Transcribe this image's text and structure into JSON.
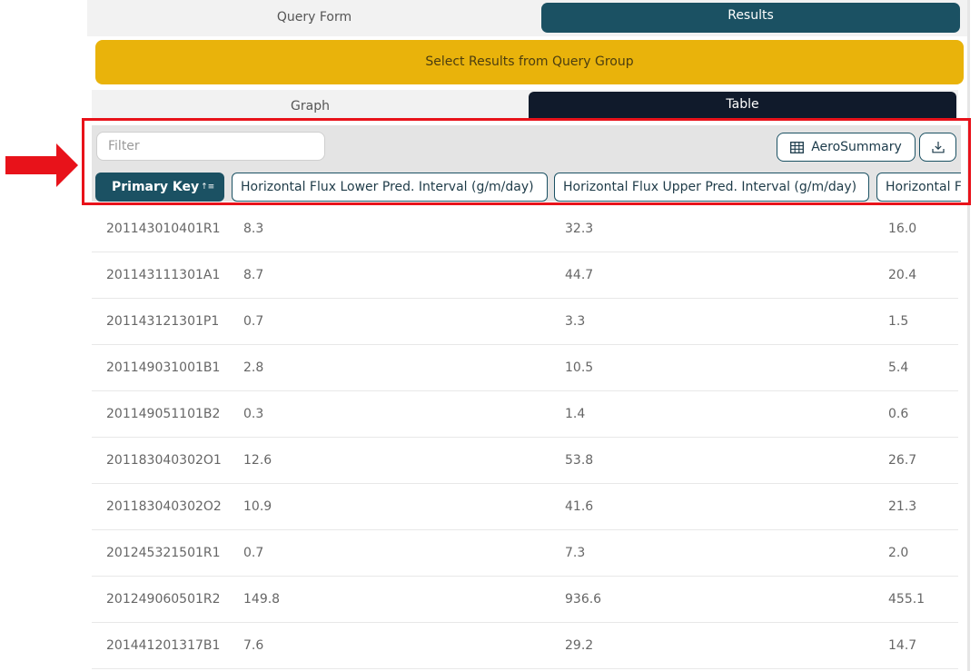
{
  "top_tabs": {
    "query_form": "Query Form",
    "results": "Results"
  },
  "banner": {
    "label": "Select Results from Query Group"
  },
  "view_tabs": {
    "graph": "Graph",
    "table": "Table"
  },
  "toolbar": {
    "filter_placeholder": "Filter",
    "aero_summary_label": "AeroSummary"
  },
  "columns": [
    {
      "label": "Primary Key",
      "sorted": "ascending"
    },
    {
      "label": "Horizontal Flux Lower Pred. Interval (g/m/day)"
    },
    {
      "label": "Horizontal Flux Upper Pred. Interval (g/m/day)"
    },
    {
      "label": "Horizontal F"
    }
  ],
  "rows": [
    [
      "201143010401R1",
      "8.3",
      "32.3",
      "16.0"
    ],
    [
      "201143111301A1",
      "8.7",
      "44.7",
      "20.4"
    ],
    [
      "201143121301P1",
      "0.7",
      "3.3",
      "1.5"
    ],
    [
      "201149031001B1",
      "2.8",
      "10.5",
      "5.4"
    ],
    [
      "201149051101B2",
      "0.3",
      "1.4",
      "0.6"
    ],
    [
      "201183040302O1",
      "12.6",
      "53.8",
      "26.7"
    ],
    [
      "201183040302O2",
      "10.9",
      "41.6",
      "21.3"
    ],
    [
      "201245321501R1",
      "0.7",
      "7.3",
      "2.0"
    ],
    [
      "201249060501R2",
      "149.8",
      "936.6",
      "455.1"
    ],
    [
      "201441201317B1",
      "7.6",
      "29.2",
      "14.7"
    ]
  ],
  "colors": {
    "accent": "#1b5163",
    "banner": "#e9b30b",
    "table_tab": "#101a2b",
    "highlight": "#e8121a"
  },
  "icons": {
    "sort": "sort-ascending-icon",
    "table": "table-grid-icon",
    "download": "download-icon",
    "arrow": "red-arrow-right-icon"
  }
}
